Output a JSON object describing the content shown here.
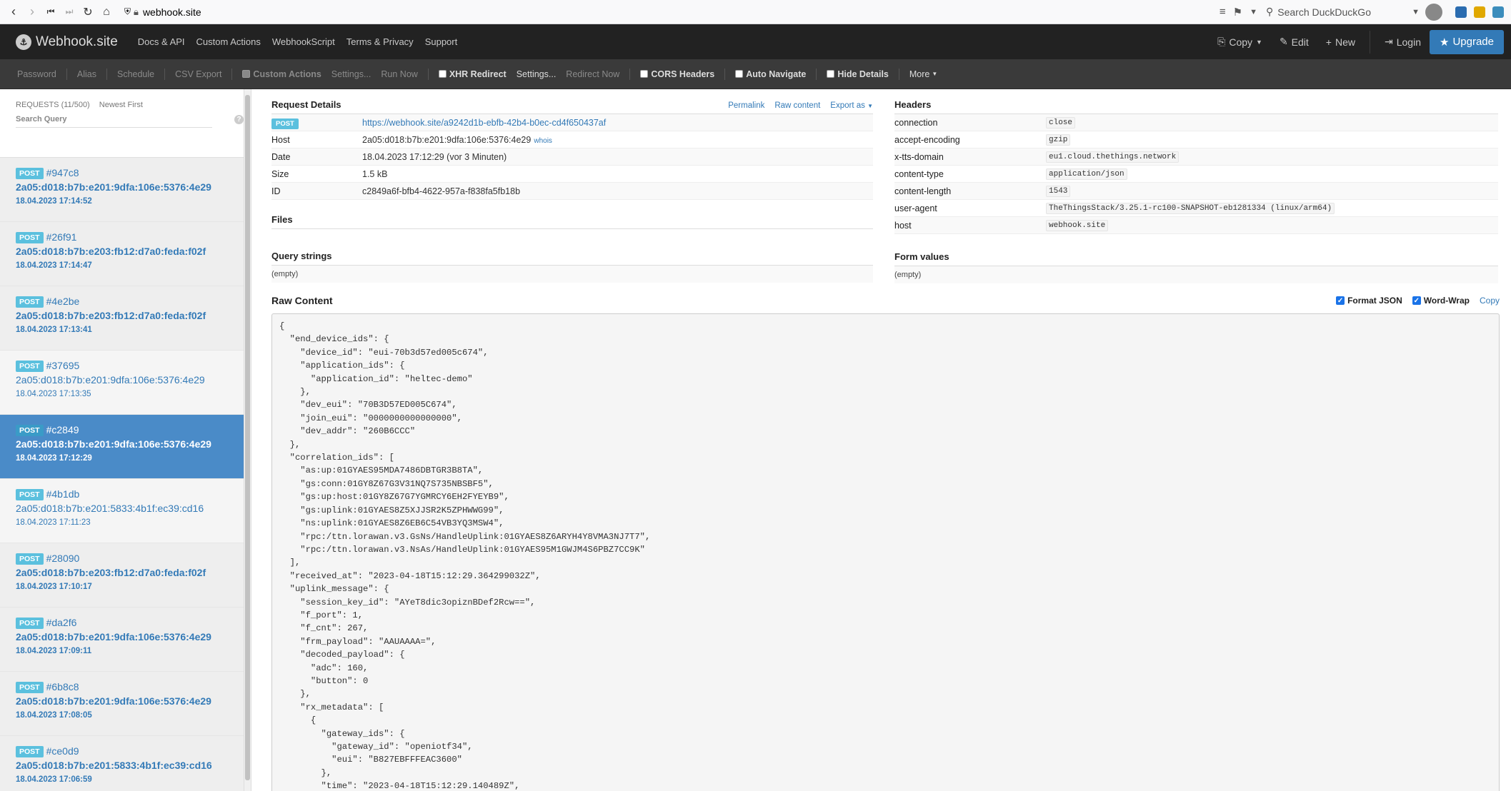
{
  "browser": {
    "url": "webhook.site",
    "search_placeholder": "Search DuckDuckGo"
  },
  "topnav": {
    "brand": "Webhook.site",
    "links": [
      "Docs & API",
      "Custom Actions",
      "WebhookScript",
      "Terms & Privacy",
      "Support"
    ],
    "copy": "Copy",
    "edit": "Edit",
    "new": "New",
    "login": "Login",
    "upgrade": "Upgrade"
  },
  "subnav": {
    "password": "Password",
    "alias": "Alias",
    "schedule": "Schedule",
    "csv_export": "CSV Export",
    "custom_actions": "Custom Actions",
    "settings": "Settings...",
    "run_now": "Run Now",
    "xhr_redirect": "XHR Redirect",
    "settings2": "Settings...",
    "redirect_now": "Redirect Now",
    "cors_headers": "CORS Headers",
    "auto_navigate": "Auto Navigate",
    "hide_details": "Hide Details",
    "more": "More"
  },
  "sidebar": {
    "count": "REQUESTS (11/500)",
    "sort": "Newest First",
    "search_placeholder": "Search Query",
    "requests": [
      {
        "method": "POST",
        "id": "#947c8",
        "ip": "2a05:d018:b7b:e201:9dfa:106e:5376:4e29",
        "time": "18.04.2023 17:14:52"
      },
      {
        "method": "POST",
        "id": "#26f91",
        "ip": "2a05:d018:b7b:e203:fb12:d7a0:feda:f02f",
        "time": "18.04.2023 17:14:47"
      },
      {
        "method": "POST",
        "id": "#4e2be",
        "ip": "2a05:d018:b7b:e203:fb12:d7a0:feda:f02f",
        "time": "18.04.2023 17:13:41"
      },
      {
        "method": "POST",
        "id": "#37695",
        "ip": "2a05:d018:b7b:e201:9dfa:106e:5376:4e29",
        "time": "18.04.2023 17:13:35"
      },
      {
        "method": "POST",
        "id": "#c2849",
        "ip": "2a05:d018:b7b:e201:9dfa:106e:5376:4e29",
        "time": "18.04.2023 17:12:29"
      },
      {
        "method": "POST",
        "id": "#4b1db",
        "ip": "2a05:d018:b7b:e201:5833:4b1f:ec39:cd16",
        "time": "18.04.2023 17:11:23"
      },
      {
        "method": "POST",
        "id": "#28090",
        "ip": "2a05:d018:b7b:e203:fb12:d7a0:feda:f02f",
        "time": "18.04.2023 17:10:17"
      },
      {
        "method": "POST",
        "id": "#da2f6",
        "ip": "2a05:d018:b7b:e201:9dfa:106e:5376:4e29",
        "time": "18.04.2023 17:09:11"
      },
      {
        "method": "POST",
        "id": "#6b8c8",
        "ip": "2a05:d018:b7b:e201:9dfa:106e:5376:4e29",
        "time": "18.04.2023 17:08:05"
      },
      {
        "method": "POST",
        "id": "#ce0d9",
        "ip": "2a05:d018:b7b:e201:5833:4b1f:ec39:cd16",
        "time": "18.04.2023 17:06:59"
      }
    ]
  },
  "details": {
    "title": "Request Details",
    "permalink": "Permalink",
    "raw_content": "Raw content",
    "export": "Export as",
    "method": "POST",
    "url": "https://webhook.site/a9242d1b-ebfb-42b4-b0ec-cd4f650437af",
    "host_label": "Host",
    "host": "2a05:d018:b7b:e201:9dfa:106e:5376:4e29",
    "whois": "whois",
    "date_label": "Date",
    "date": "18.04.2023 17:12:29 (vor 3 Minuten)",
    "size_label": "Size",
    "size": "1.5 kB",
    "id_label": "ID",
    "id": "c2849a6f-bfb4-4622-957a-f838fa5fb18b",
    "files": "Files",
    "query_strings": "Query strings",
    "query_empty": "(empty)"
  },
  "headers": {
    "title": "Headers",
    "rows": [
      {
        "k": "connection",
        "v": "close"
      },
      {
        "k": "accept-encoding",
        "v": "gzip"
      },
      {
        "k": "x-tts-domain",
        "v": "eu1.cloud.thethings.network"
      },
      {
        "k": "content-type",
        "v": "application/json"
      },
      {
        "k": "content-length",
        "v": "1543"
      },
      {
        "k": "user-agent",
        "v": "TheThingsStack/3.25.1-rc100-SNAPSHOT-eb1281334 (linux/arm64)"
      },
      {
        "k": "host",
        "v": "webhook.site"
      }
    ],
    "form_values": "Form values",
    "form_empty": "(empty)"
  },
  "raw": {
    "title": "Raw Content",
    "format_json": "Format JSON",
    "word_wrap": "Word-Wrap",
    "copy": "Copy",
    "body": "{\n  \"end_device_ids\": {\n    \"device_id\": \"eui-70b3d57ed005c674\",\n    \"application_ids\": {\n      \"application_id\": \"heltec-demo\"\n    },\n    \"dev_eui\": \"70B3D57ED005C674\",\n    \"join_eui\": \"0000000000000000\",\n    \"dev_addr\": \"260B6CCC\"\n  },\n  \"correlation_ids\": [\n    \"as:up:01GYAES95MDA7486DBTGR3B8TA\",\n    \"gs:conn:01GY8Z67G3V31NQ7S735NBSBF5\",\n    \"gs:up:host:01GY8Z67G7YGMRCY6EH2FYEYB9\",\n    \"gs:uplink:01GYAES8Z5XJJSR2K5ZPHWWG99\",\n    \"ns:uplink:01GYAES8Z6EB6C54VB3YQ3MSW4\",\n    \"rpc:/ttn.lorawan.v3.GsNs/HandleUplink:01GYAES8Z6ARYH4Y8VMA3NJ7T7\",\n    \"rpc:/ttn.lorawan.v3.NsAs/HandleUplink:01GYAES95M1GWJM4S6PBZ7CC9K\"\n  ],\n  \"received_at\": \"2023-04-18T15:12:29.364299032Z\",\n  \"uplink_message\": {\n    \"session_key_id\": \"AYeT8dic3opiznBDef2Rcw==\",\n    \"f_port\": 1,\n    \"f_cnt\": 267,\n    \"frm_payload\": \"AAUAAAA=\",\n    \"decoded_payload\": {\n      \"adc\": 160,\n      \"button\": 0\n    },\n    \"rx_metadata\": [\n      {\n        \"gateway_ids\": {\n          \"gateway_id\": \"openiotf34\",\n          \"eui\": \"B827EBFFFEAC3600\"\n        },\n        \"time\": \"2023-04-18T15:12:29.140489Z\","
  }
}
